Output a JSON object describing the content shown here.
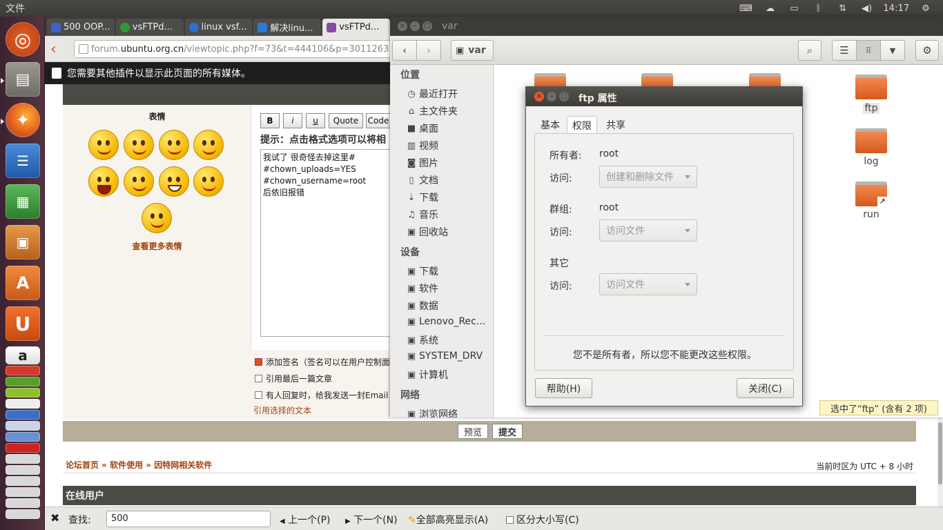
{
  "top_panel": {
    "menu_title": "文件",
    "time": "14:17",
    "tray_icons": [
      "keyboard-icon",
      "cloud-icon",
      "battery-icon",
      "bluetooth-icon",
      "network-icon",
      "volume-icon"
    ]
  },
  "launcher": {
    "apps": [
      "ubuntu-logo-icon",
      "files-icon",
      "firefox-icon",
      "writer-icon",
      "calc-icon",
      "impress-icon",
      "software-center-icon",
      "u-app-icon",
      "amazon-icon"
    ]
  },
  "browser": {
    "tabs": [
      {
        "label": "500 OOP...",
        "color": "#3d63c9"
      },
      {
        "label": "vsFTPd...",
        "color": "#2e9a3c"
      },
      {
        "label": "linux vsf...",
        "color": "#2d6fd6"
      },
      {
        "label": "解决linu...",
        "color": "#2b7bd2"
      },
      {
        "label": "vsFTPd...",
        "color": "#8a4aa8"
      }
    ],
    "url_prefix": "forum.",
    "url_domain": "ubuntu.org.cn",
    "url_path": "/viewtopic.php?f=73&t=444106&p=3011263",
    "plugin_notice": "您需要其他插件以显示此页面的所有媒体。",
    "emoticons_title": "表情",
    "more_emoticons": "查看更多表情",
    "format_buttons": [
      "B",
      "i",
      "u",
      "Quote",
      "Code"
    ],
    "hint": "提示：点击格式选项可以将相",
    "post_text": "我试了 很奇怪去掉这里#\n#chown_uploads=YES\n#chown_username=root\n后依旧报错",
    "options": {
      "add_signature": "添加签名（签名可以在用户控制面",
      "quote_last": "引用最后一篇文章",
      "notify_reply": "有人回复时，给我发送一封Email",
      "quote_selected": "引用选择的文本"
    },
    "preview": "预览",
    "submit": "提交",
    "breadcrumb": "论坛首页 » 软件使用 » 因特网相关软件",
    "timezone": "当前时区为 UTC + 8 小时",
    "online_users": "在线用户",
    "findbar": {
      "label": "查找:",
      "value": "500",
      "prev": "上一个(P)",
      "next": "下一个(N)",
      "highlight_all": "全部高亮显示(A)",
      "match_case": "区分大小写(C)"
    }
  },
  "files": {
    "window_title": "var",
    "path_label": "var",
    "sidebar": {
      "places_title": "位置",
      "places": [
        "最近打开",
        "主文件夹",
        "桌面",
        "视频",
        "图片",
        "文档",
        "下载",
        "音乐",
        "回收站"
      ],
      "devices_title": "设备",
      "devices": [
        "下载",
        "软件",
        "数据",
        "Lenovo_Rec...",
        "系统",
        "SYSTEM_DRV",
        "计算机"
      ],
      "network_title": "网络",
      "network": [
        "浏览网络"
      ]
    },
    "folders": [
      "ftp",
      "log",
      "run"
    ],
    "status": "选中了“ftp” (含有 2 项)"
  },
  "dialog": {
    "title": "ftp 属性",
    "tabs": [
      "基本",
      "权限",
      "共享"
    ],
    "owner_label": "所有者:",
    "owner_value": "root",
    "access_label": "访问:",
    "owner_access": "创建和删除文件",
    "group_label": "群组:",
    "group_value": "root",
    "group_access": "访问文件",
    "others_label": "其它",
    "others_access": "访问文件",
    "note": "您不是所有者，所以您不能更改这些权限。",
    "help_button": "帮助(H)",
    "close_button": "关闭(C)"
  }
}
